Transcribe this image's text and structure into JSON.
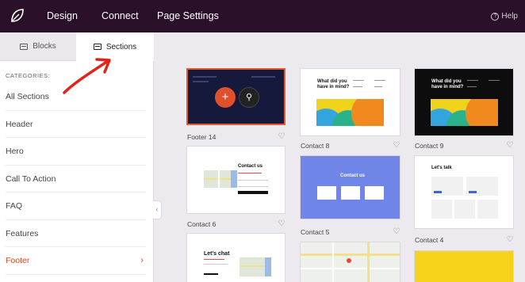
{
  "topbar": {
    "logo_icon": "leaf-logo-icon",
    "nav": [
      "Design",
      "Connect",
      "Page Settings"
    ],
    "help_label": "Help",
    "background": "#2a1029"
  },
  "sidebar": {
    "tabs": [
      {
        "label": "Blocks",
        "icon": "blocks-icon",
        "active": false
      },
      {
        "label": "Sections",
        "icon": "sections-icon",
        "active": true
      }
    ],
    "categories_label": "CATEGORIES:",
    "categories": [
      {
        "label": "All Sections"
      },
      {
        "label": "Header"
      },
      {
        "label": "Hero"
      },
      {
        "label": "Call To Action"
      },
      {
        "label": "FAQ"
      },
      {
        "label": "Features"
      },
      {
        "label": "Footer",
        "active": true
      }
    ],
    "accent": "#d9451c"
  },
  "sections": [
    {
      "caption": "Footer 14",
      "selected": true
    },
    {
      "caption": "Contact 8",
      "heading": "What did you have in mind?"
    },
    {
      "caption": "Contact 9",
      "heading": "What did you have in mind?"
    },
    {
      "caption": "Contact 6",
      "heading": "Contact us"
    },
    {
      "caption": "Contact 5",
      "heading": "Contact us"
    },
    {
      "caption": "Contact 4",
      "heading": "Let's talk"
    },
    {
      "caption": "",
      "heading": "Let's chat"
    },
    {
      "caption": ""
    },
    {
      "caption": ""
    }
  ]
}
